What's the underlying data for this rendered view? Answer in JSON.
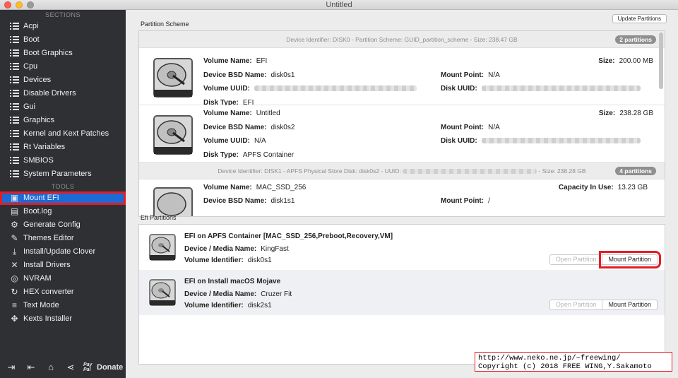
{
  "window": {
    "title": "Untitled"
  },
  "sidebar": {
    "sections_label": "SECTIONS",
    "tools_label": "TOOLS",
    "sections": [
      {
        "label": "Acpi"
      },
      {
        "label": "Boot"
      },
      {
        "label": "Boot Graphics"
      },
      {
        "label": "Cpu"
      },
      {
        "label": "Devices"
      },
      {
        "label": "Disable Drivers"
      },
      {
        "label": "Gui"
      },
      {
        "label": "Graphics"
      },
      {
        "label": "Kernel and Kext Patches"
      },
      {
        "label": "Rt Variables"
      },
      {
        "label": "SMBIOS"
      },
      {
        "label": "System Parameters"
      }
    ],
    "tools": [
      {
        "label": "Mount EFI",
        "icon": "disk-icon",
        "active": true
      },
      {
        "label": "Boot.log",
        "icon": "log-icon"
      },
      {
        "label": "Generate Config",
        "icon": "gear-icon"
      },
      {
        "label": "Themes Editor",
        "icon": "brush-icon"
      },
      {
        "label": "Install/Update Clover",
        "icon": "download-icon"
      },
      {
        "label": "Install Drivers",
        "icon": "wrench-icon"
      },
      {
        "label": "NVRAM",
        "icon": "chip-icon"
      },
      {
        "label": "HEX converter",
        "icon": "refresh-icon"
      },
      {
        "label": "Text Mode",
        "icon": "text-icon"
      },
      {
        "label": "Kexts Installer",
        "icon": "puzzle-icon"
      }
    ],
    "footer": {
      "paypal_label": "Pay Pal",
      "donate_label": "Donate"
    }
  },
  "main": {
    "update_button": "Update Partitions",
    "partition_scheme_label": "Partition Scheme",
    "efi_partitions_label": "Efi Partitions",
    "disks": [
      {
        "header": "Device Identifier: DISK0 - Partition Scheme: GUID_partition_scheme - Size: 238.47 GB",
        "badge": "2 partitions",
        "partitions": [
          {
            "volume_name_label": "Volume Name:",
            "volume_name": "EFI",
            "bsd_label": "Device BSD Name:",
            "bsd": "disk0s1",
            "uuid_label": "Volume UUID:",
            "type_label": "Disk Type:",
            "type": "EFI",
            "size_label": "Size:",
            "size": "200.00 MB",
            "mount_label": "Mount Point:",
            "mount": "N/A",
            "disk_uuid_label": "Disk UUID:"
          },
          {
            "volume_name_label": "Volume Name:",
            "volume_name": "Untitled",
            "bsd_label": "Device BSD Name:",
            "bsd": "disk0s2",
            "uuid_label": "Volume UUID:",
            "uuid": "N/A",
            "type_label": "Disk Type:",
            "type": "APFS Container",
            "size_label": "Size:",
            "size": "238.28 GB",
            "mount_label": "Mount Point:",
            "mount": "N/A",
            "disk_uuid_label": "Disk UUID:"
          }
        ]
      },
      {
        "header_prefix": "Device Identifier: DISK1 - APFS Physical Store Disk: disk0s2 - UUID:",
        "header_suffix": "- Size: 238.28 GB",
        "badge": "4 partitions",
        "partitions": [
          {
            "volume_name_label": "Volume Name:",
            "volume_name": "MAC_SSD_256",
            "bsd_label": "Device BSD Name:",
            "bsd": "disk1s1",
            "capacity_label": "Capacity In Use:",
            "capacity": "13.23 GB",
            "mount_label": "Mount Point:",
            "mount": "/"
          }
        ]
      }
    ],
    "efi_entries": [
      {
        "title": "EFI on APFS Container [MAC_SSD_256,Preboot,Recovery,VM]",
        "media_label": "Device / Media Name:",
        "media": "KingFast",
        "vol_label": "Volume Identifier:",
        "vol": "disk0s1",
        "open_label": "Open Partition",
        "mount_label": "Mount Partition"
      },
      {
        "title": "EFI on Install macOS Mojave",
        "media_label": "Device / Media Name:",
        "media": "Cruzer Fit",
        "vol_label": "Volume Identifier:",
        "vol": "disk2s1",
        "open_label": "Open Partition",
        "mount_label": "Mount Partition"
      }
    ]
  },
  "credit": {
    "line1": "http://www.neko.ne.jp/~freewing/",
    "line2": "Copyright (c) 2018 FREE WING,Y.Sakamoto"
  },
  "colors": {
    "sidebar_bg": "#2f3033",
    "active_item": "#1b6ad6",
    "highlight": "#e41c24"
  }
}
